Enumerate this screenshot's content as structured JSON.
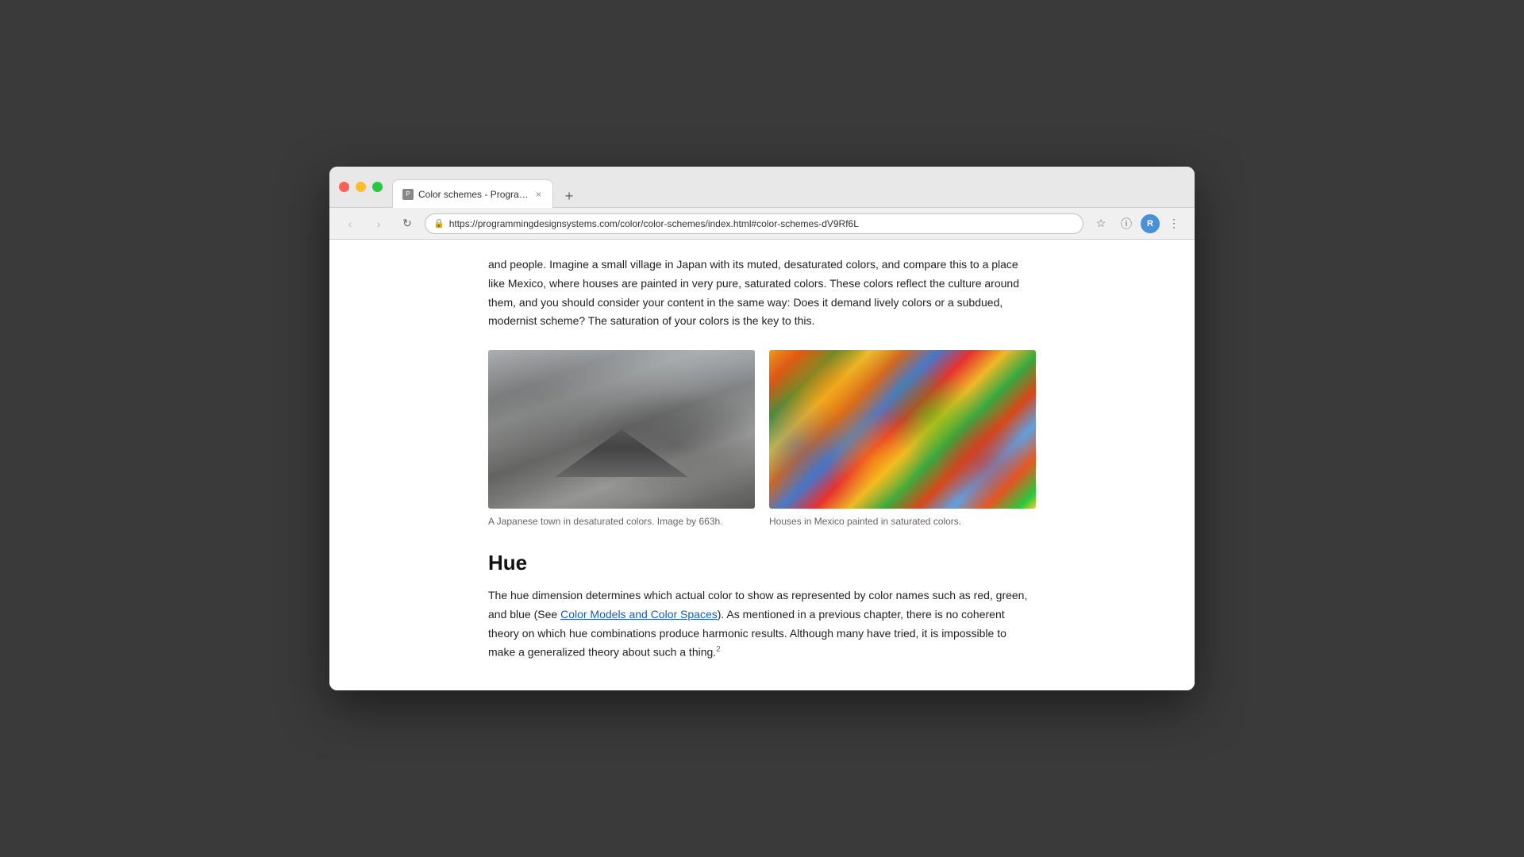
{
  "browser": {
    "traffic_lights": [
      "red",
      "yellow",
      "green"
    ],
    "tab": {
      "label": "Color schemes - Programmin...",
      "close": "×"
    },
    "new_tab_btn": "+",
    "nav": {
      "back_btn": "‹",
      "forward_btn": "›",
      "refresh_btn": "↻",
      "url": "https://programmingdesignsystems.com/color/color-schemes/index.html#color-schemes-dV9Rf6L",
      "lock_icon": "🔒"
    },
    "nav_actions": {
      "bookmark": "☆",
      "info": "ⓘ",
      "avatar_label": "R",
      "menu": "⋮"
    }
  },
  "page": {
    "intro_paragraph": "and people. Imagine a small village in Japan with its muted, desaturated colors, and compare this to a place like Mexico, where houses are painted in very pure, saturated colors. These colors reflect the culture around them, and you should consider your content in the same way: Does it demand lively colors or a subdued, modernist scheme? The saturation of your colors is the key to this.",
    "images": [
      {
        "id": "japan",
        "caption": "A Japanese town in desaturated colors. Image by 663h."
      },
      {
        "id": "mexico",
        "caption": "Houses in Mexico painted in saturated colors."
      }
    ],
    "hue_section": {
      "heading": "Hue",
      "paragraph_start": "The hue dimension determines which actual color to show as represented by color names such as red, green, and blue (See ",
      "link_text": "Color Models and Color Spaces",
      "paragraph_middle": "). As mentioned in a previous chapter, there is no coherent theory on which hue combinations produce harmonic results. Although many have tried, it is impossible to make a generalized theory about such a thing.",
      "footnote": "2"
    }
  }
}
